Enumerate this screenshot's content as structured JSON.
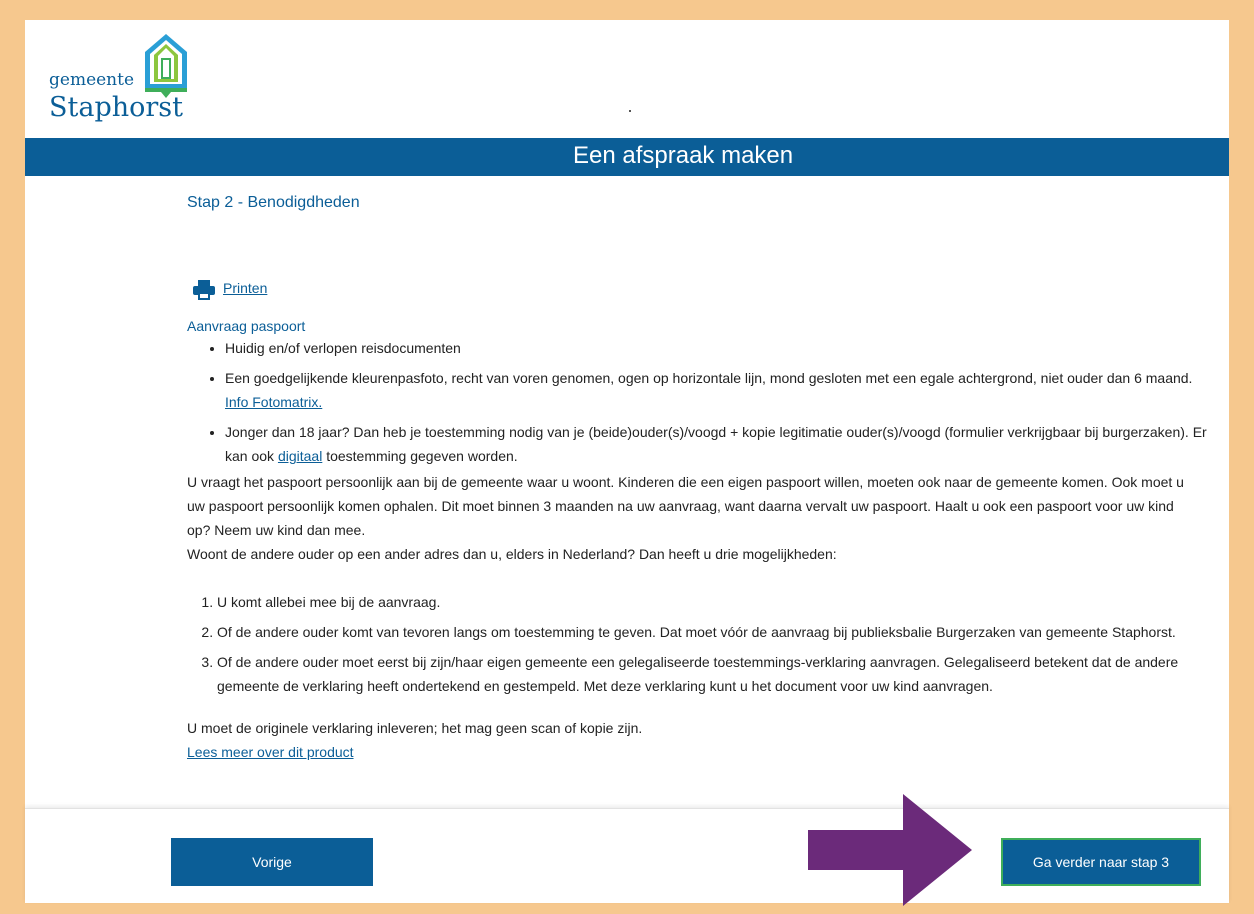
{
  "header": {
    "logo_small": "gemeente",
    "logo_big": "Staphorst"
  },
  "banner": {
    "title": "Een afspraak maken"
  },
  "content": {
    "step_heading": "Stap 2 - Benodigdheden",
    "print_label": "Printen",
    "section_title": "Aanvraag paspoort",
    "bullets": {
      "b1": "Huidig en/of verlopen reisdocumenten",
      "b2_text": "Een goedgelijkende kleurenpasfoto, recht van voren genomen, ogen op horizontale lijn, mond gesloten met een egale achtergrond, niet ouder dan 6 maand.",
      "b2_link": "Info Fotomatrix.",
      "b3_text": "Jonger dan 18 jaar? Dan heb je toestemming nodig van je (beide)ouder(s)/voogd + kopie legitimatie ouder(s)/voogd (formulier verkrijgbaar bij burgerzaken). Er kan ook",
      "b3_link": "digitaal",
      "b3_after": "toestemming gegeven worden."
    },
    "paragraph1": "U vraagt het paspoort persoonlijk aan bij de gemeente waar u woont. Kinderen die een eigen paspoort willen, moeten ook naar de gemeente komen. Ook moet u uw paspoort persoonlijk komen ophalen. Dit moet binnen 3 maanden na uw aanvraag, want daarna vervalt uw paspoort. Haalt u ook een paspoort voor uw kind op? Neem uw kind dan mee.",
    "paragraph2": "Woont de andere ouder op een ander adres dan u, elders in Nederland? Dan heeft u drie mogelijkheden:",
    "numbered": {
      "n1": "U komt allebei mee bij de aanvraag.",
      "n2": "Of de andere ouder komt van tevoren langs om toestemming te geven. Dat moet vóór de aanvraag bij publieksbalie Burgerzaken van gemeente Staphorst.",
      "n3": "Of de andere ouder moet eerst bij zijn/haar eigen gemeente een gelegaliseerde toestemmings-verklaring aanvragen. Gelegaliseerd betekent dat de andere gemeente de verklaring heeft ondertekend en gestempeld. Met deze verklaring kunt u het document voor uw kind aanvragen."
    },
    "final_text": "U moet de originele verklaring inleveren; het mag geen scan of kopie zijn.",
    "read_more": "Lees meer over dit product"
  },
  "footer": {
    "prev_label": "Vorige",
    "next_label": "Ga verder naar stap 3"
  },
  "colors": {
    "brand_blue": "#0b5e97",
    "frame_bg": "#f6c88e",
    "arrow": "#6b2a7a",
    "logo_green": "#3fae5a"
  },
  "icons": [
    "logo-house-icon",
    "printer-icon",
    "arrow-right-icon"
  ]
}
